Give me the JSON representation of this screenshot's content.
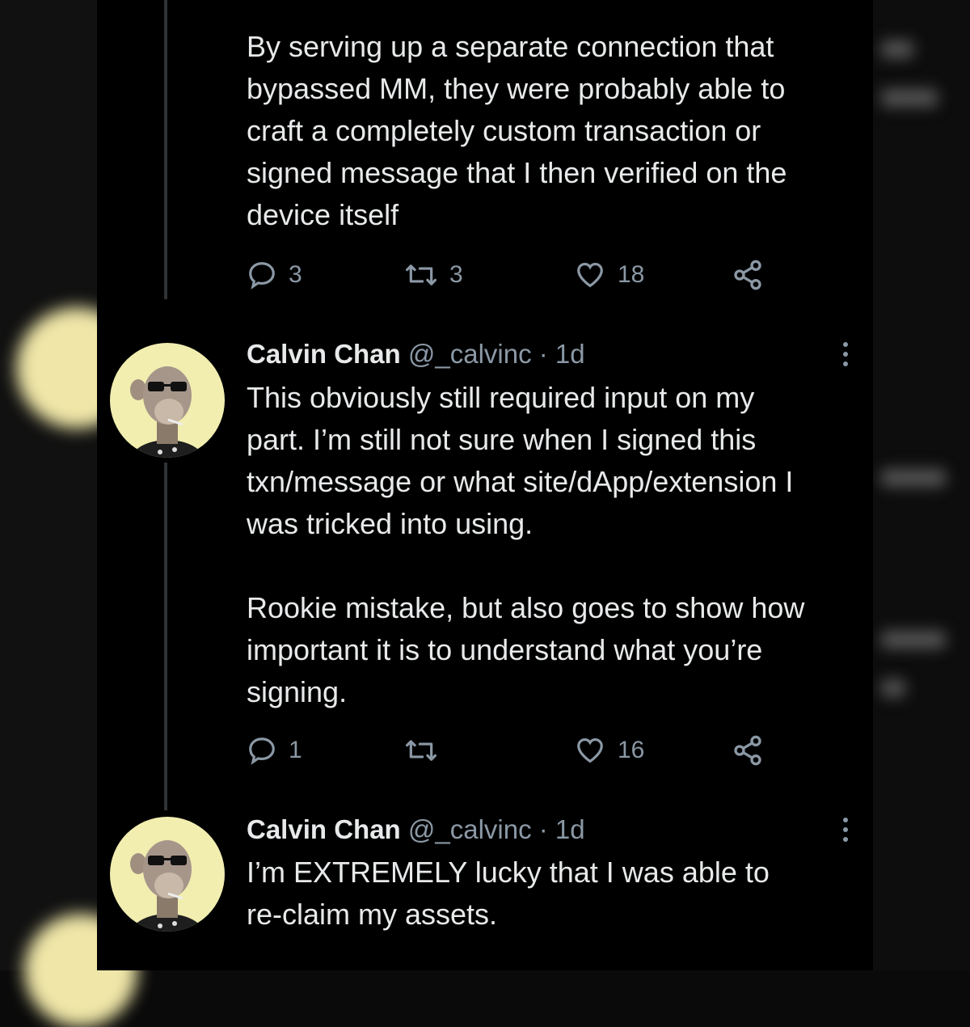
{
  "tweets": [
    {
      "text": "By serving up a separate connection that\nbypassed MM, they were probably able to\ncraft a completely custom transaction or\nsigned message that I then verified on the\ndevice itself",
      "replies": "3",
      "retweets": "3",
      "likes": "18"
    },
    {
      "name": "Calvin Chan",
      "handle": "@_calvinc",
      "time": " · 1d",
      "text": "This obviously still required input on my\npart. I’m still not sure when I signed this\ntxn/message or what site/dApp/extension I\nwas tricked into using.\n\nRookie mistake, but also goes to show how\nimportant it is to understand what you’re\nsigning.",
      "replies": "1",
      "retweets": "",
      "likes": "16"
    },
    {
      "name": "Calvin Chan",
      "handle": "@_calvinc",
      "time": " · 1d",
      "text": "I’m EXTREMELY lucky that I was able to\nre-claim my assets."
    }
  ],
  "icons": {
    "reply": "reply-icon",
    "retweet": "retweet-icon",
    "like": "heart-icon",
    "share": "share-icon",
    "more": "more-icon"
  },
  "colors": {
    "background": "#000000",
    "text": "#e7e9ea",
    "muted": "#8b98a5",
    "avatar_bg": "#f1eeb0"
  }
}
